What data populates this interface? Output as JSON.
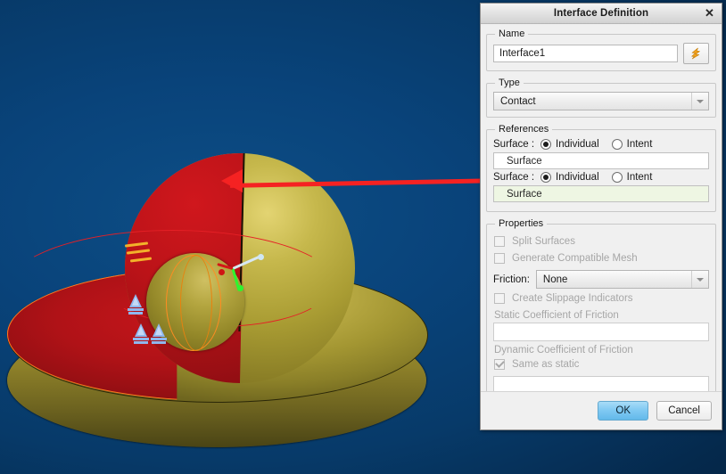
{
  "dialog": {
    "title": "Interface Definition",
    "close_icon": "close-icon",
    "name_group": {
      "legend": "Name",
      "value": "Interface1",
      "placeholder": "",
      "icon_button": "flash-icon"
    },
    "type_group": {
      "legend": "Type",
      "selected": "Contact",
      "caret_icon": "chevron-down-icon"
    },
    "references_group": {
      "legend": "References",
      "rows": [
        {
          "label": "Surface :",
          "option_individual": "Individual",
          "option_intent": "Intent",
          "selected": "Individual",
          "field_value": "Surface",
          "highlighted": false
        },
        {
          "label": "Surface :",
          "option_individual": "Individual",
          "option_intent": "Intent",
          "selected": "Individual",
          "field_value": "Surface",
          "highlighted": true
        }
      ]
    },
    "properties_group": {
      "legend": "Properties",
      "split_surfaces": {
        "label": "Split Surfaces",
        "checked": false,
        "enabled": false
      },
      "generate_compatible_mesh": {
        "label": "Generate Compatible Mesh",
        "checked": false,
        "enabled": false
      },
      "friction": {
        "label": "Friction:",
        "selected": "None",
        "caret_icon": "chevron-down-icon"
      },
      "create_slippage_indicators": {
        "label": "Create Slippage Indicators",
        "checked": false,
        "enabled": false
      },
      "static_coefficient": {
        "label": "Static Coefficient of Friction",
        "value": "",
        "enabled": false
      },
      "dynamic_coefficient": {
        "label": "Dynamic Coefficient of Friction",
        "value": "",
        "enabled": false
      },
      "same_as_static": {
        "label": "Same as static",
        "checked": true,
        "enabled": false
      }
    },
    "buttons": {
      "ok": "OK",
      "cancel": "Cancel"
    }
  },
  "annotation": {
    "arrow": "red-arrow-pointing-left",
    "highlight_box": "red-rectangle-highlight",
    "color": "#f52222"
  },
  "viewport": {
    "background_color": "#09437a",
    "model_name": "3d-cad-model",
    "gold_color": "#a99c33",
    "red_surface_color": "#bb1318",
    "constraint_symbol_color": "#8fb7ee",
    "axis_colors": {
      "x": "#d8e8f2",
      "y": "#2ef52e",
      "z": "#d41717"
    }
  }
}
